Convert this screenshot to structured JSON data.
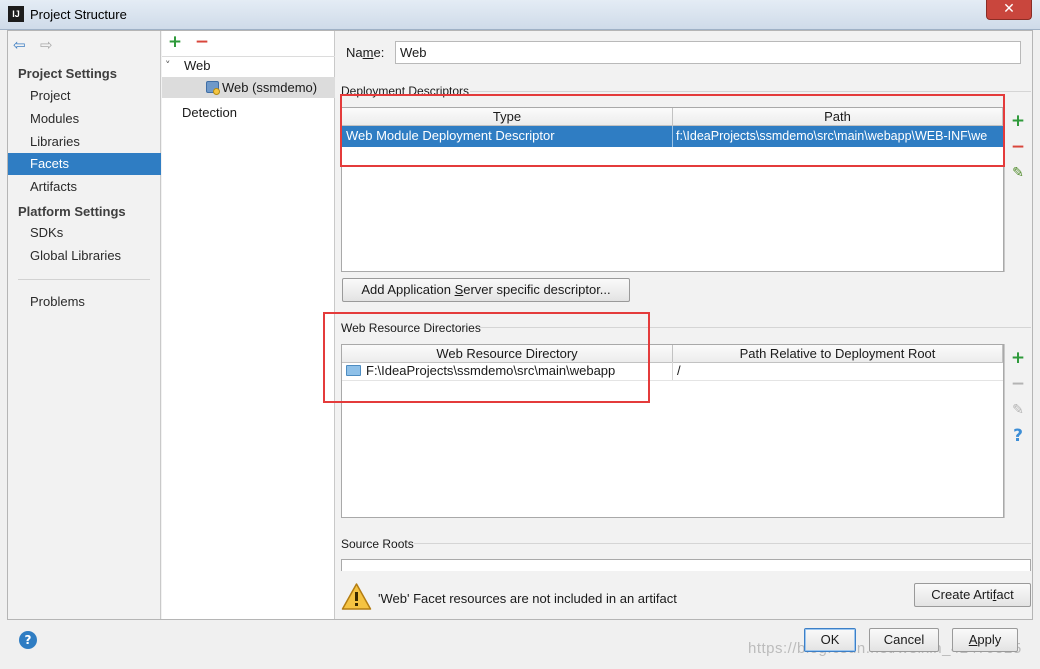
{
  "window": {
    "title": "Project Structure",
    "app_icon": "IJ",
    "close_glyph": "✕"
  },
  "nav": {
    "back_glyph": "⇦",
    "forward_glyph": "⇨"
  },
  "sidebar": {
    "project_settings_heading": "Project Settings",
    "project_items": [
      "Project",
      "Modules",
      "Libraries",
      "Facets",
      "Artifacts"
    ],
    "selected": "Facets",
    "platform_settings_heading": "Platform Settings",
    "platform_items": [
      "SDKs",
      "Global Libraries"
    ],
    "problems": "Problems"
  },
  "tree": {
    "add_glyph": "+",
    "remove_glyph": "−",
    "root": "Web",
    "expand_glyph": "˅",
    "child": "Web (ssmdemo)",
    "detection": "Detection"
  },
  "facet": {
    "name_label_prefix": "Na",
    "name_label_mnemonic": "m",
    "name_label_suffix": "e:",
    "name_value": "Web",
    "deployment_descriptors": {
      "heading": "Deployment Descriptors",
      "columns": [
        "Type",
        "Path"
      ],
      "rows": [
        {
          "type": "Web Module Deployment Descriptor",
          "path": "f:\\IdeaProjects\\ssmdemo\\src\\main\\webapp\\WEB-INF\\we"
        }
      ]
    },
    "add_server_descriptor_button_prefix": "Add Application ",
    "add_server_descriptor_button_mnemonic": "S",
    "add_server_descriptor_button_suffix": "erver specific descriptor...",
    "web_resource_directories": {
      "heading": "Web Resource Directories",
      "columns": [
        "Web Resource Directory",
        "Path Relative to Deployment Root"
      ],
      "rows": [
        {
          "directory": "F:\\IdeaProjects\\ssmdemo\\src\\main\\webapp",
          "relative_path": "/"
        }
      ]
    },
    "source_roots": {
      "heading": "Source Roots"
    },
    "warning_text": "'Web' Facet resources are not included in an artifact",
    "create_artifact_button_prefix": "Create Arti",
    "create_artifact_button_mnemonic": "f",
    "create_artifact_button_suffix": "act"
  },
  "tools": {
    "add": "+",
    "remove": "−",
    "edit": "✎",
    "help": "?"
  },
  "footer": {
    "help_glyph": "?",
    "ok": "OK",
    "cancel": "Cancel",
    "apply_mnemonic": "A",
    "apply_suffix": "pply"
  },
  "watermark": "https://blog.csdn.net/weixin_42479525",
  "colors": {
    "selection": "#2f7dc3",
    "add_green": "#2f9a3b",
    "remove_red": "#d9463b",
    "annotation_red": "#e43b3b"
  }
}
